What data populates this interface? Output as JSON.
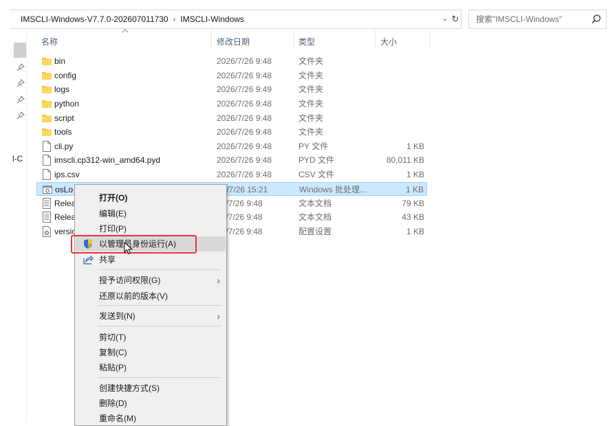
{
  "address_bar": {
    "crumbs": [
      "IMSCLI-Windows-V7.7.0-202607011730",
      "IMSCLI-Windows"
    ],
    "separator": "›",
    "dropdown_icon": "chevron-down-icon",
    "refresh_icon": "refresh-icon"
  },
  "search": {
    "placeholder": "搜索\"IMSCLI-Windows\"",
    "icon": "search-icon"
  },
  "nav_pane": {
    "partial_text": "l-C"
  },
  "columns": {
    "name": "名称",
    "date": "修改日期",
    "type": "类型",
    "size": "大小"
  },
  "files": [
    {
      "name": "bin",
      "date": "2026/7/26 9:48",
      "type": "文件夹",
      "size": "",
      "icon": "folder-icon"
    },
    {
      "name": "config",
      "date": "2026/7/26 9:48",
      "type": "文件夹",
      "size": "",
      "icon": "folder-icon"
    },
    {
      "name": "logs",
      "date": "2026/7/26 9:49",
      "type": "文件夹",
      "size": "",
      "icon": "folder-icon"
    },
    {
      "name": "python",
      "date": "2026/7/26 9:48",
      "type": "文件夹",
      "size": "",
      "icon": "folder-icon"
    },
    {
      "name": "script",
      "date": "2026/7/26 9:48",
      "type": "文件夹",
      "size": "",
      "icon": "folder-icon"
    },
    {
      "name": "tools",
      "date": "2026/7/26 9:48",
      "type": "文件夹",
      "size": "",
      "icon": "folder-icon"
    },
    {
      "name": "cli.py",
      "date": "2026/7/26 9:48",
      "type": "PY 文件",
      "size": "1 KB",
      "icon": "file-icon"
    },
    {
      "name": "imscli.cp312-win_amd64.pyd",
      "date": "2026/7/26 9:48",
      "type": "PYD 文件",
      "size": "80,011 KB",
      "icon": "file-icon"
    },
    {
      "name": "ips.csv",
      "date": "2026/7/26 9:48",
      "type": "CSV 文件",
      "size": "1 KB",
      "icon": "file-icon"
    },
    {
      "name": "osLo",
      "date": "26/7/26 15:21",
      "type": "Windows 批处理...",
      "size": "1 KB",
      "icon": "batch-file-icon",
      "selected": true
    },
    {
      "name": "Relea",
      "date": "26/7/26 9:48",
      "type": "文本文档",
      "size": "79 KB",
      "icon": "text-file-icon"
    },
    {
      "name": "Relea",
      "date": "26/7/26 9:48",
      "type": "文本文档",
      "size": "43 KB",
      "icon": "text-file-icon"
    },
    {
      "name": "versic",
      "date": "26/7/26 9:48",
      "type": "配置设置",
      "size": "1 KB",
      "icon": "config-file-icon"
    }
  ],
  "context_menu": {
    "items": [
      {
        "label": "打开(O)",
        "bold": true
      },
      {
        "label": "编辑(E)"
      },
      {
        "label": "打印(P)"
      },
      {
        "label": "以管理员身份运行(A)",
        "icon": "uac-shield-icon",
        "highlighted": true
      },
      {
        "label": "共享",
        "icon": "share-icon"
      },
      {
        "label": "授予访问权限(G)",
        "submenu": true
      },
      {
        "label": "还原以前的版本(V)"
      },
      {
        "label": "发送到(N)",
        "submenu": true
      },
      {
        "label": "剪切(T)"
      },
      {
        "label": "复制(C)"
      },
      {
        "label": "粘贴(P)"
      },
      {
        "label": "创建快捷方式(S)"
      },
      {
        "label": "删除(D)"
      },
      {
        "label": "重命名(M)"
      }
    ],
    "submenu_glyph": "›"
  },
  "colors": {
    "selection_bg": "#cce8ff",
    "selection_border": "#99d1ff",
    "highlight_box": "#e8333b",
    "menu_bg": "#f0f0f0",
    "folder": "#f5c143",
    "header_text": "#4c607a"
  }
}
